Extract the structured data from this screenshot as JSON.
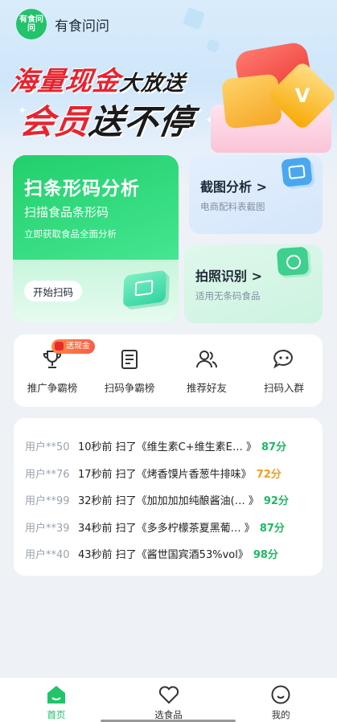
{
  "app": {
    "logo_text": "有食问问",
    "title": "有食问问"
  },
  "promo": {
    "line1_red": "海量现金",
    "line1_dark": "大放送",
    "line2_red": "会员",
    "line2_dark": "送不停",
    "badge_letter": "V"
  },
  "scan_card": {
    "title": "扫条形码分析",
    "subtitle": "扫描食品条形码",
    "desc": "立即获取食品全面分析",
    "button": "开始扫码"
  },
  "screenshot_card": {
    "title": "截图分析 >",
    "desc": "电商配料表截图"
  },
  "photo_card": {
    "title": "拍照识别 >",
    "desc": "适用无条码食品"
  },
  "quick_menu": {
    "badge": "送现金",
    "items": [
      {
        "label": "推广争霸榜",
        "icon": "trophy-icon"
      },
      {
        "label": "扫码争霸榜",
        "icon": "list-icon"
      },
      {
        "label": "推荐好友",
        "icon": "friends-icon"
      },
      {
        "label": "扫码入群",
        "icon": "chat-icon"
      }
    ]
  },
  "feed": [
    {
      "user": "用户**50",
      "text": "10秒前 扫了《维生素C+维生素E… 》",
      "score": "87分",
      "score_color": "#1fb864"
    },
    {
      "user": "用户**76",
      "text": "17秒前 扫了《烤香馍片香葱牛排味》",
      "score": "72分",
      "score_color": "#f29c1f"
    },
    {
      "user": "用户**99",
      "text": "32秒前 扫了《加加加加纯酿酱油(… 》",
      "score": "92分",
      "score_color": "#1fb864"
    },
    {
      "user": "用户**39",
      "text": "34秒前 扫了《多多柠檬茶夏黑葡… 》",
      "score": "87分",
      "score_color": "#1fb864"
    },
    {
      "user": "用户**40",
      "text": "43秒前 扫了《酱世国宾酒53%vol》",
      "score": "98分",
      "score_color": "#1fb864"
    }
  ],
  "nav": {
    "items": [
      {
        "label": "首页",
        "icon": "home-icon",
        "active": true
      },
      {
        "label": "选食品",
        "icon": "heart-icon",
        "active": false
      },
      {
        "label": "我的",
        "icon": "smile-icon",
        "active": false
      }
    ]
  },
  "colors": {
    "brand_green": "#22c36a",
    "promo_red": "#e8232f",
    "score_green": "#1fb864",
    "score_orange": "#f29c1f"
  }
}
